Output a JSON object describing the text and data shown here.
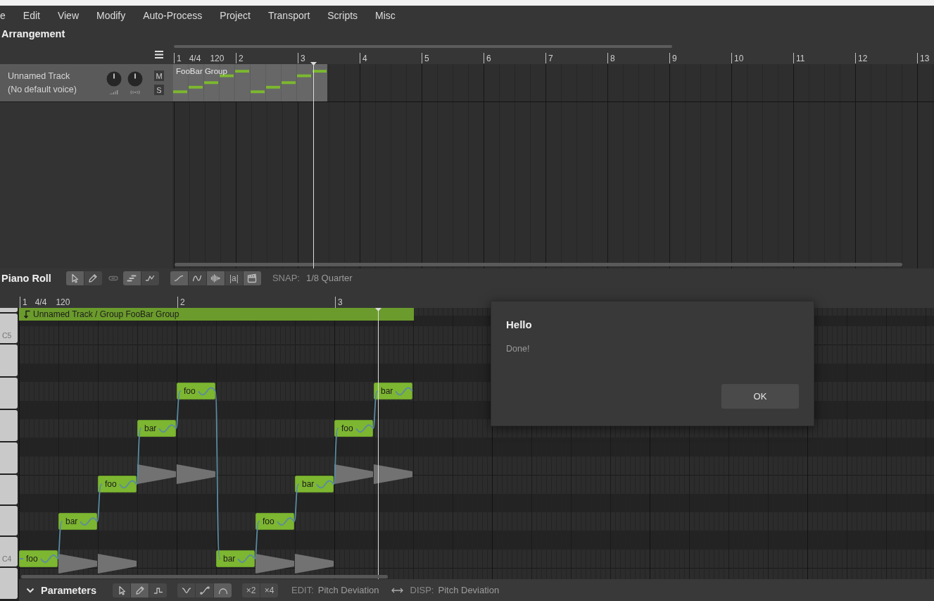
{
  "menu": [
    "e",
    "Edit",
    "View",
    "Modify",
    "Auto-Process",
    "Project",
    "Transport",
    "Scripts",
    "Misc"
  ],
  "arrangement": {
    "title": "Arrangement",
    "ruler": {
      "bars": [
        "1",
        "2",
        "3",
        "4",
        "5",
        "6",
        "7",
        "8",
        "9",
        "10",
        "11",
        "12",
        "13"
      ],
      "time_signature": "4/4",
      "tempo": "120"
    },
    "tracks": [
      {
        "name": "Unnamed Track",
        "voice": "(No default voice)",
        "knobs": [
          {
            "kind": "volume"
          },
          {
            "kind": "pan"
          }
        ],
        "mute": {
          "label": "M",
          "on": false
        },
        "solo": {
          "label": "S",
          "on": false
        },
        "group": {
          "label": "FooBar Group"
        }
      }
    ]
  },
  "piano_roll": {
    "title": "Piano Roll",
    "toolbar": [
      {
        "buttons": [
          {
            "kind": "pointer",
            "selected": true
          },
          {
            "kind": "pencil",
            "selected": false
          }
        ]
      },
      {
        "buttons": [
          {
            "kind": "link",
            "disabled": true
          }
        ]
      },
      {
        "buttons": [
          {
            "kind": "notes",
            "selected": true
          },
          {
            "kind": "pitch",
            "selected": false
          }
        ]
      },
      {
        "buttons": [
          {
            "kind": "curve",
            "selected": true
          },
          {
            "kind": "wave_curve",
            "selected": false
          },
          {
            "kind": "waveform",
            "selected": true
          },
          {
            "kind": "text",
            "label": "|a|",
            "selected": false
          },
          {
            "kind": "clapper",
            "selected": true
          }
        ]
      }
    ],
    "snap": {
      "label": "SNAP:",
      "value": "1/8 Quarter"
    },
    "ruler": {
      "bars": [
        "1",
        "2",
        "3"
      ],
      "time_signature": "4/4",
      "tempo": "120"
    },
    "group_bar": {
      "label": "Unnamed Track / Group FooBar Group"
    },
    "keys": [
      {
        "label": "C5"
      },
      {
        "label": "C4"
      }
    ],
    "notes": [
      {
        "lyric": "foo"
      },
      {
        "lyric": "bar"
      },
      {
        "lyric": "foo"
      },
      {
        "lyric": "bar"
      },
      {
        "lyric": "foo"
      },
      {
        "lyric": "bar"
      },
      {
        "lyric": "foo"
      },
      {
        "lyric": "bar"
      },
      {
        "lyric": "foo"
      },
      {
        "lyric": "bar"
      }
    ]
  },
  "parameters": {
    "title": "Parameters",
    "toolbar": [
      {
        "buttons": [
          {
            "kind": "pointer",
            "selected": false
          },
          {
            "kind": "pencil",
            "selected": true
          },
          {
            "kind": "step",
            "selected": false
          }
        ]
      },
      {
        "buttons": [
          {
            "kind": "vee",
            "selected": false
          },
          {
            "kind": "slope",
            "selected": false
          },
          {
            "kind": "arch",
            "selected": true
          }
        ]
      },
      {
        "buttons": [
          {
            "kind": "text",
            "label": "×2",
            "selected": false
          },
          {
            "kind": "text",
            "label": "×4",
            "selected": false
          }
        ]
      }
    ],
    "edit": {
      "label": "EDIT:",
      "value": "Pitch Deviation"
    },
    "display": {
      "label": "DISP:",
      "value": "Pitch Deviation"
    }
  },
  "dialog": {
    "title": "Hello",
    "message": "Done!",
    "buttons": [
      "OK"
    ]
  }
}
